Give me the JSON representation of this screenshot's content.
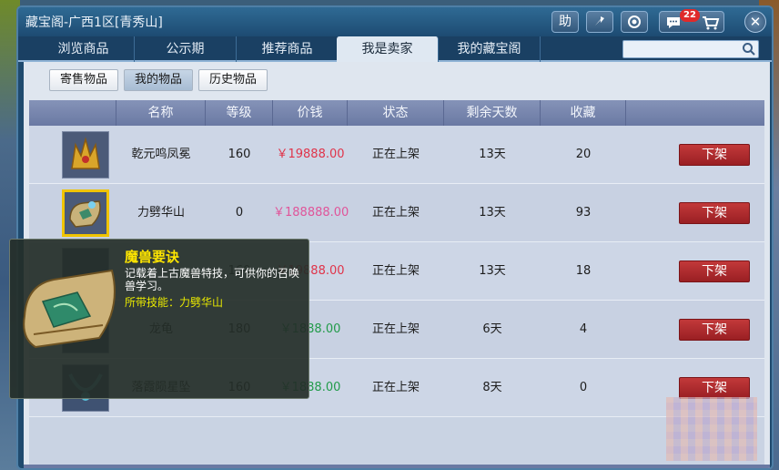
{
  "window": {
    "title": "藏宝阁-广西1区[青秀山]",
    "help_label": "助",
    "message_count": "22"
  },
  "tabs": [
    {
      "label": "浏览商品"
    },
    {
      "label": "公示期"
    },
    {
      "label": "推荐商品"
    },
    {
      "label": "我是卖家"
    },
    {
      "label": "我的藏宝阁"
    }
  ],
  "search": {
    "placeholder": ""
  },
  "subtabs": [
    {
      "label": "寄售物品"
    },
    {
      "label": "我的物品"
    },
    {
      "label": "历史物品"
    }
  ],
  "table": {
    "headers": [
      "名称",
      "等级",
      "价钱",
      "状态",
      "剩余天数",
      "收藏"
    ],
    "action_label": "下架",
    "rows": [
      {
        "name": "乾元鸣凤冕",
        "level": "160",
        "price": "￥19888.00",
        "status": "正在上架",
        "days": "13天",
        "fav": "20"
      },
      {
        "name": "力劈华山",
        "level": "0",
        "price": "￥188888.00",
        "status": "正在上架",
        "days": "13天",
        "fav": "93"
      },
      {
        "name": "",
        "level": "160",
        "price": "￥19888.00",
        "status": "正在上架",
        "days": "13天",
        "fav": "18"
      },
      {
        "name": "龙龟",
        "level": "180",
        "price": "￥1888.00",
        "status": "正在上架",
        "days": "6天",
        "fav": "4"
      },
      {
        "name": "落霞陨星坠",
        "level": "160",
        "price": "￥1888.00",
        "status": "正在上架",
        "days": "8天",
        "fav": "0"
      }
    ]
  },
  "tooltip": {
    "title": "魔兽要诀",
    "description": "记载着上古魔兽特技，可供你的召唤兽学习。",
    "skill": "所带技能：力劈华山"
  },
  "colors": {
    "price_red": "#e0344a",
    "price_pink": "#e0559a",
    "price_green": "#229b4a",
    "action_red": "#b02a2e"
  }
}
